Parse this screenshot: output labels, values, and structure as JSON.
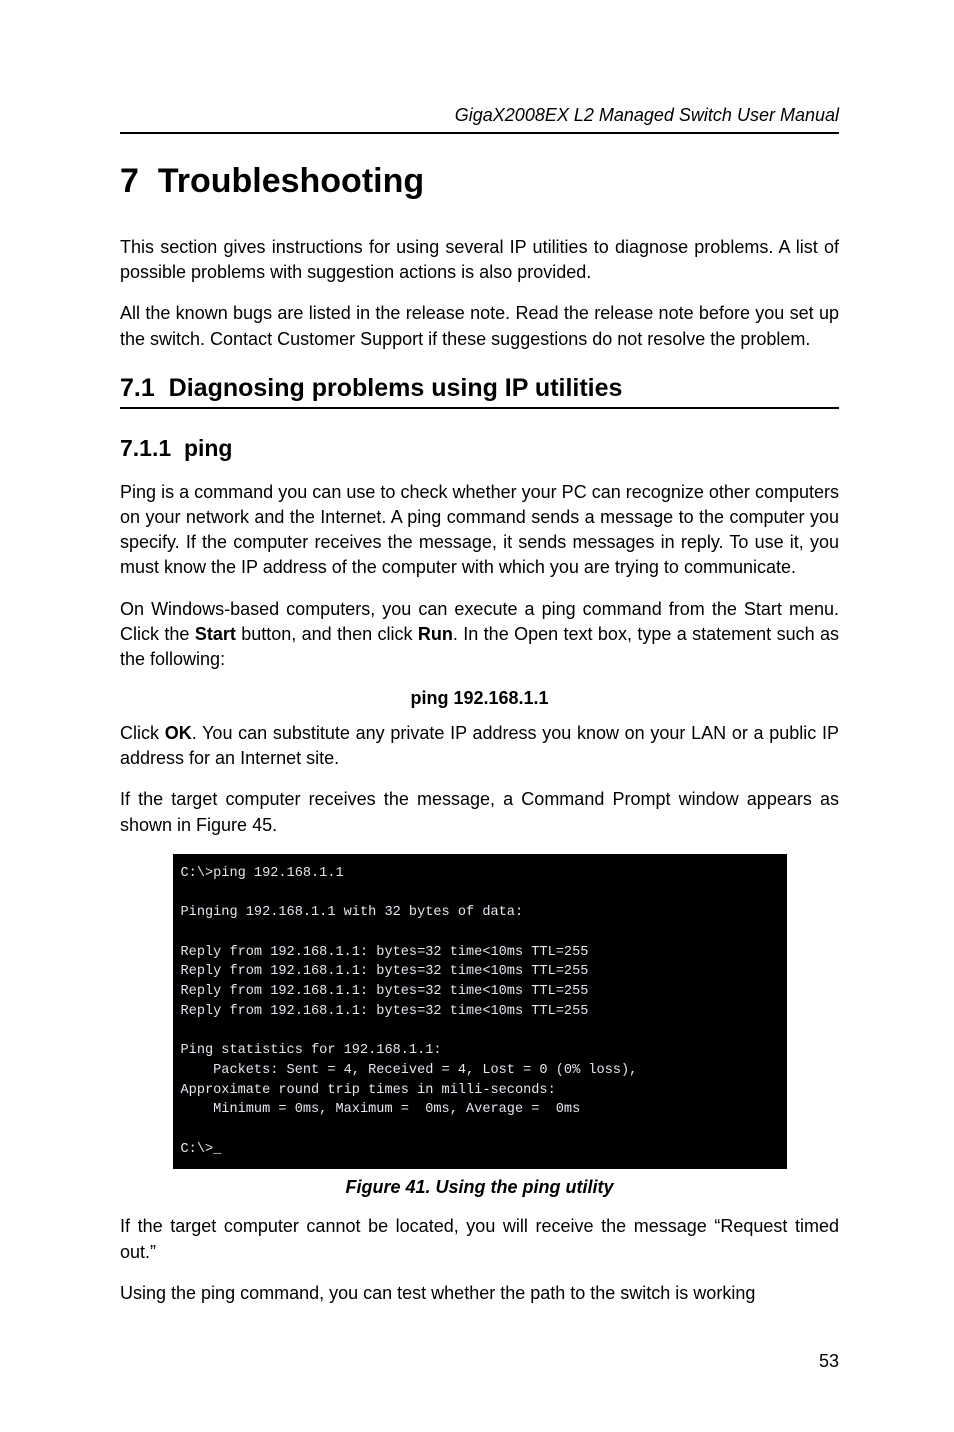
{
  "running_head": "GigaX2008EX L2 Managed Switch User Manual",
  "chapter": {
    "num": "7",
    "title": "Troubleshooting"
  },
  "p1": "This section gives instructions for using several IP utilities to diagnose problems. A list of possible problems with suggestion actions is also provided.",
  "p2": "All the known bugs are listed in the release note. Read the release note before you set up the switch. Contact Customer Support if these suggestions do not resolve the problem.",
  "sec71": {
    "num": "7.1",
    "title": "Diagnosing problems using IP utilities"
  },
  "sec711": {
    "num": "7.1.1",
    "title": "ping"
  },
  "p3": "Ping is a command you can use to check whether your PC can recognize other computers on your network and the Internet. A ping command sends a message to the computer you specify. If the computer receives the message, it sends messages in reply. To use it, you must know the IP address of the computer with which you are trying to communicate.",
  "p4a": "On Windows-based computers, you can execute a ping command from the Start menu. Click the ",
  "p4b": "Start",
  "p4c": " button, and then click ",
  "p4d": "Run",
  "p4e": ". In the Open text box, type a statement such as the following:",
  "cmd": "ping 192.168.1.1",
  "p5a": "Click ",
  "p5b": "OK",
  "p5c": ". You can substitute any private IP address you know on your LAN or a public IP address for an Internet site.",
  "p6": "If the target computer receives the message, a Command Prompt window appears as shown in Figure  45.",
  "terminal": "C:\\>ping 192.168.1.1\n\nPinging 192.168.1.1 with 32 bytes of data:\n\nReply from 192.168.1.1: bytes=32 time<10ms TTL=255\nReply from 192.168.1.1: bytes=32 time<10ms TTL=255\nReply from 192.168.1.1: bytes=32 time<10ms TTL=255\nReply from 192.168.1.1: bytes=32 time<10ms TTL=255\n\nPing statistics for 192.168.1.1:\n    Packets: Sent = 4, Received = 4, Lost = 0 (0% loss),\nApproximate round trip times in milli-seconds:\n    Minimum = 0ms, Maximum =  0ms, Average =  0ms\n\nC:\\>_",
  "caption": "Figure 41. Using the ping utility",
  "p7": "If the target computer cannot be located, you will receive the message “Request timed out.”",
  "p8": "Using the ping command, you can test whether the path to the switch is working",
  "page_number": "53"
}
